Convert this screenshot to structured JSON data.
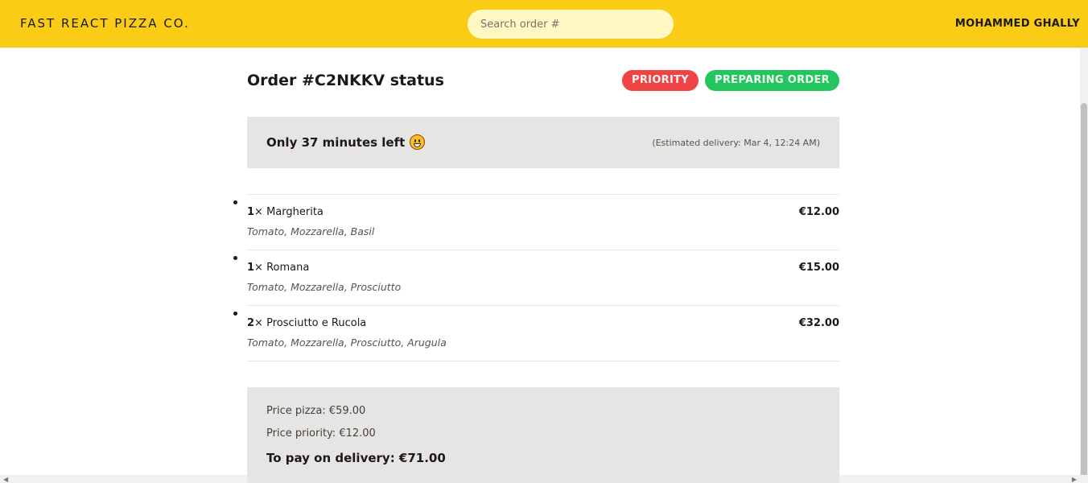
{
  "header": {
    "logo": "Fast React Pizza Co.",
    "search_placeholder": "Search order #",
    "username": "Mohammed Ghally"
  },
  "order": {
    "title": "Order #C2NKKV status",
    "badges": {
      "priority": "Priority",
      "status": "Preparing order"
    },
    "eta": {
      "message": "Only 37 minutes left",
      "estimated": "(Estimated delivery: Mar 4, 12:24 AM)"
    },
    "items": [
      {
        "qty": "1",
        "times": "×",
        "name": "Margherita",
        "price": "€12.00",
        "ingredients": "Tomato, Mozzarella, Basil"
      },
      {
        "qty": "1",
        "times": "×",
        "name": "Romana",
        "price": "€15.00",
        "ingredients": "Tomato, Mozzarella, Prosciutto"
      },
      {
        "qty": "2",
        "times": "×",
        "name": "Prosciutto e Rucola",
        "price": "€32.00",
        "ingredients": "Tomato, Mozzarella, Prosciutto, Arugula"
      }
    ],
    "totals": {
      "price_pizza": "Price pizza: €59.00",
      "price_priority": "Price priority: €12.00",
      "to_pay": "To pay on delivery: €71.00"
    }
  },
  "colors": {
    "header_bg": "#facc15",
    "search_bg": "#fef9c3",
    "priority_badge": "#ef4444",
    "status_badge": "#22c55e",
    "panel_bg": "#e7e5e4"
  },
  "icons": {
    "eta": "grinning-face-emoji-icon"
  }
}
